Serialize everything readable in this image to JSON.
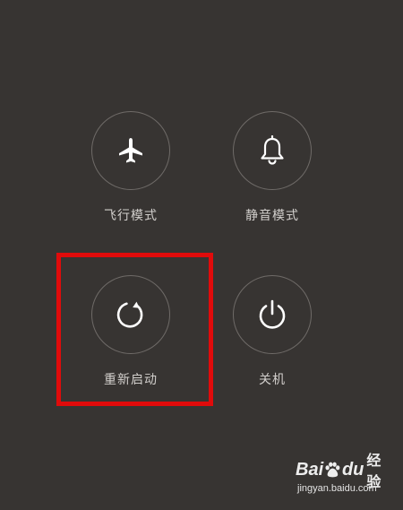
{
  "power_menu": {
    "options": [
      {
        "id": "airplane",
        "label": "飞行模式",
        "icon": "airplane-icon"
      },
      {
        "id": "silent",
        "label": "静音模式",
        "icon": "bell-icon"
      },
      {
        "id": "restart",
        "label": "重新启动",
        "icon": "restart-icon"
      },
      {
        "id": "power_off",
        "label": "关机",
        "icon": "power-icon"
      }
    ]
  },
  "watermark": {
    "brand_bai": "Bai",
    "brand_du": "du",
    "product": "经验",
    "url": "jingyan.baidu.com"
  },
  "colors": {
    "background": "#373432",
    "circle_border": "#6f6b68",
    "icon": "#ffffff",
    "label": "#d2cfcc",
    "highlight": "#e00b0b"
  }
}
